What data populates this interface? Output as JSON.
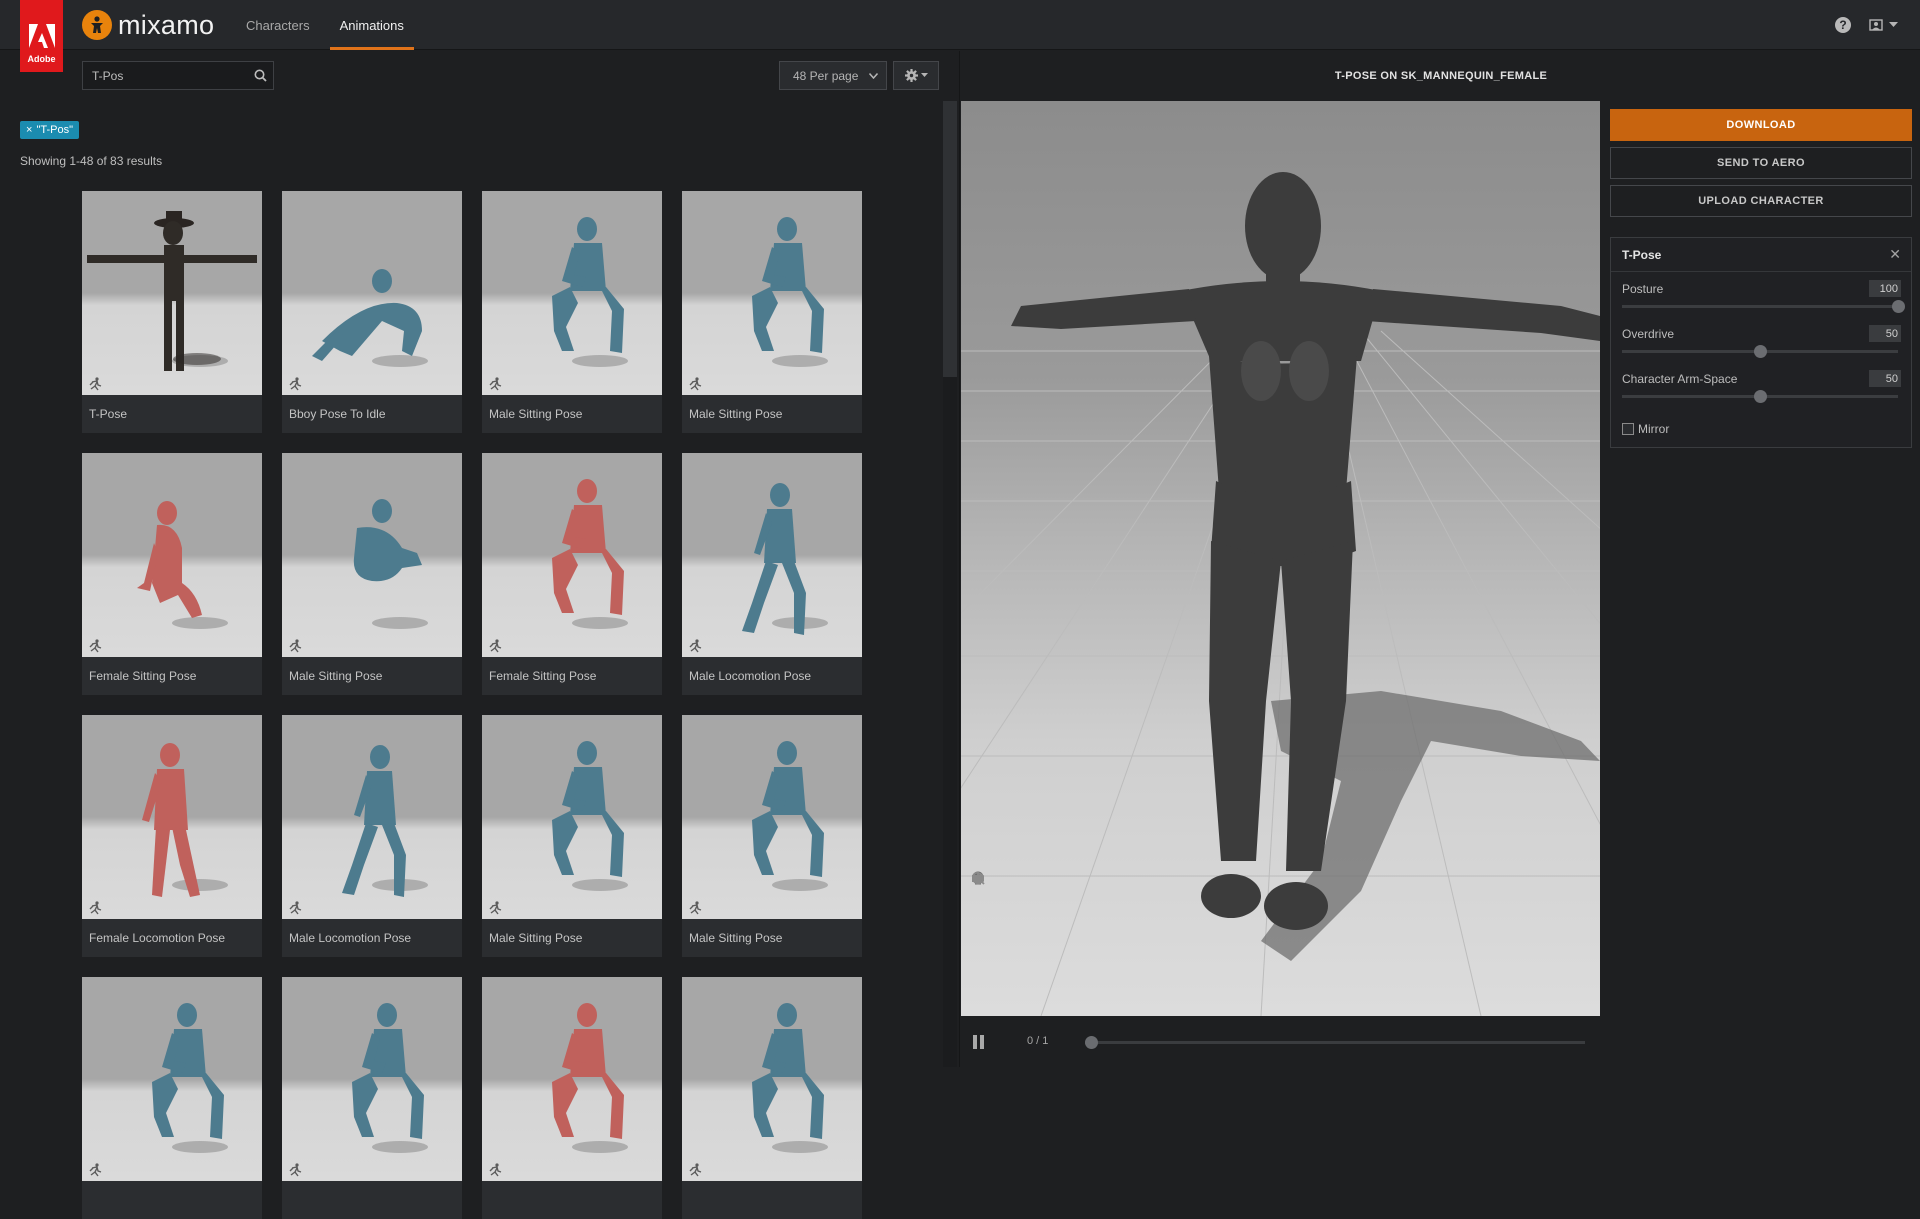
{
  "brand": {
    "adobe_label": "Adobe",
    "name": "mixamo"
  },
  "nav": {
    "tabs": [
      {
        "label": "Characters"
      },
      {
        "label": "Animations"
      }
    ],
    "active": "Animations"
  },
  "topbar_icons": [
    "help-icon",
    "user-avatar-icon",
    "chevron-down-icon"
  ],
  "search": {
    "value": "T-Pos",
    "placeholder": ""
  },
  "per_page": {
    "selected": "48 Per page"
  },
  "filter_tag": {
    "label": "\"T-Pos\"",
    "remove": "×"
  },
  "results": {
    "text": "Showing 1-48 of 83 results"
  },
  "grid": {
    "cards": [
      {
        "label": "T-Pose",
        "color": "dark",
        "pose": "tpose"
      },
      {
        "label": "Bboy Pose To Idle",
        "color": "#4d7b8e",
        "pose": "crawl"
      },
      {
        "label": "Male Sitting Pose",
        "color": "#4d7b8e",
        "pose": "sit"
      },
      {
        "label": "Male Sitting Pose",
        "color": "#4d7b8e",
        "pose": "sit"
      },
      {
        "label": "Female Sitting Pose",
        "color": "#c0615c",
        "pose": "floor"
      },
      {
        "label": "Male Sitting Pose",
        "color": "#4d7b8e",
        "pose": "cross"
      },
      {
        "label": "Female Sitting Pose",
        "color": "#c0615c",
        "pose": "sit"
      },
      {
        "label": "Male Locomotion Pose",
        "color": "#4d7b8e",
        "pose": "walk"
      },
      {
        "label": "Female Locomotion Pose",
        "color": "#c0615c",
        "pose": "stand"
      },
      {
        "label": "Male Locomotion Pose",
        "color": "#4d7b8e",
        "pose": "walk"
      },
      {
        "label": "Male Sitting Pose",
        "color": "#4d7b8e",
        "pose": "sit"
      },
      {
        "label": "Male Sitting Pose",
        "color": "#4d7b8e",
        "pose": "sit"
      },
      {
        "label": "",
        "color": "#4d7b8e",
        "pose": "sit"
      },
      {
        "label": "",
        "color": "#4d7b8e",
        "pose": "sit"
      },
      {
        "label": "",
        "color": "#c0615c",
        "pose": "sit"
      },
      {
        "label": "",
        "color": "#4d7b8e",
        "pose": "sit"
      }
    ]
  },
  "viewer": {
    "title": "T-POSE ON SK_MANNEQUIN_FEMALE",
    "frame": "0 / 1",
    "progress": 0,
    "tools": [
      "skull-icon",
      "undo-icon",
      "move-icon",
      "zoom-icon",
      "power-icon",
      "camera-icon"
    ]
  },
  "actions": {
    "download": "DOWNLOAD",
    "send_aero": "SEND TO AERO",
    "upload": "UPLOAD CHARACTER"
  },
  "animation_panel": {
    "name": "T-Pose",
    "close": "✕",
    "params": [
      {
        "label": "Posture",
        "value": "100",
        "fraction": 1.0
      },
      {
        "label": "Overdrive",
        "value": "50",
        "fraction": 0.5
      },
      {
        "label": "Character Arm-Space",
        "value": "50",
        "fraction": 0.5
      }
    ],
    "mirror_label": "Mirror",
    "mirror_checked": false
  },
  "colors": {
    "accent": "#c8640f",
    "tab_underline": "#e0731a",
    "tag": "#1b8cb0",
    "adobe_red": "#e0191c"
  }
}
